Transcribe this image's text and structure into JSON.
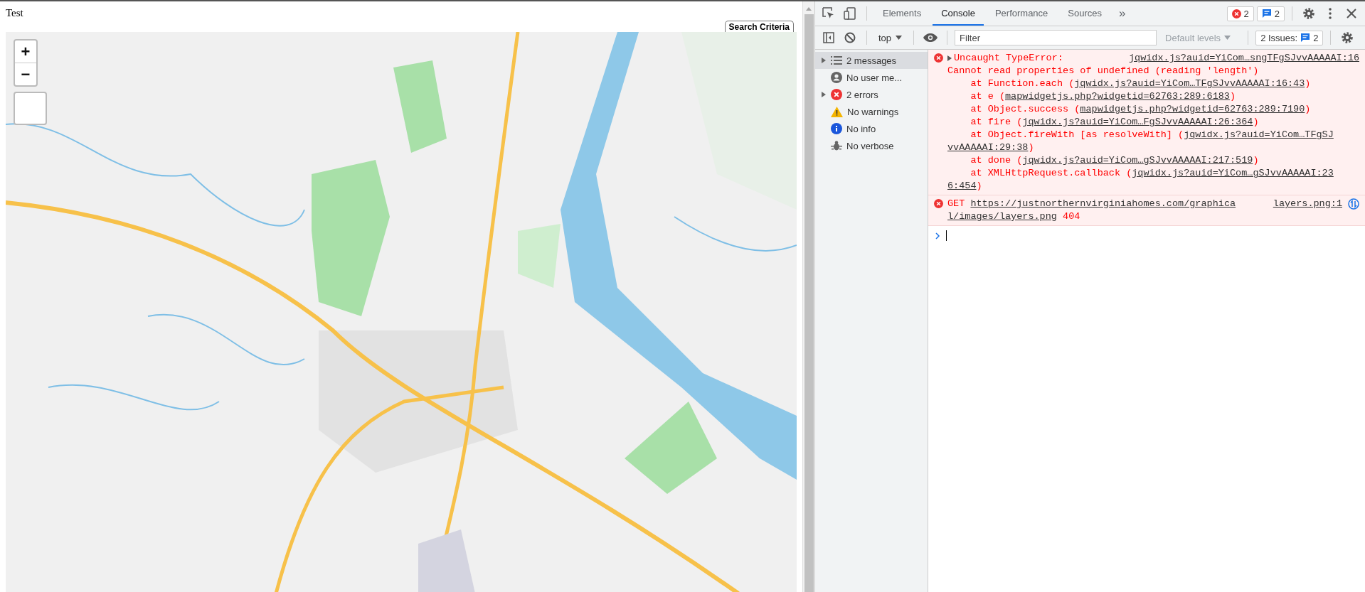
{
  "page": {
    "title": "Test",
    "search_tab": "Search Criteria",
    "map": {
      "kind": "picture",
      "zoom_in": "+",
      "zoom_out": "−"
    }
  },
  "devtools": {
    "tabs": [
      {
        "label": "Elements",
        "selected": false
      },
      {
        "label": "Console",
        "selected": true
      },
      {
        "label": "Performance",
        "selected": false
      },
      {
        "label": "Sources",
        "selected": false
      }
    ],
    "more_tabs": "»",
    "error_badge": "2",
    "message_badge": "2",
    "toolbar": {
      "context": "top",
      "filter_placeholder": "Filter",
      "levels": "Default levels",
      "issues_label": "2 Issues:",
      "issues_count": "2"
    },
    "sidebar": [
      {
        "kind": "messages",
        "label": "2 messages",
        "expandable": true,
        "selected": true
      },
      {
        "kind": "user",
        "label": "No user me...",
        "expandable": false,
        "selected": false
      },
      {
        "kind": "errors",
        "label": "2 errors",
        "expandable": true,
        "selected": false
      },
      {
        "kind": "warnings",
        "label": "No warnings",
        "expandable": false,
        "selected": false
      },
      {
        "kind": "info",
        "label": "No info",
        "expandable": false,
        "selected": false
      },
      {
        "kind": "verbose",
        "label": "No verbose",
        "expandable": false,
        "selected": false
      }
    ],
    "messages": [
      {
        "kind": "error",
        "expandable": true,
        "head": "Uncaught TypeError:",
        "source": "jqwidx.js?auid=YiCom…sngTFgSJvvAAAAAI:16",
        "lines": [
          [
            {
              "text": "Cannot read properties of undefined (reading 'length')",
              "link": false
            }
          ],
          [
            {
              "text": "    at Function.each (",
              "link": false
            },
            {
              "text": "jqwidx.js?auid=YiCom…TFgSJvvAAAAAI:16:43",
              "link": true
            },
            {
              "text": ")",
              "link": false
            }
          ],
          [
            {
              "text": "    at e (",
              "link": false
            },
            {
              "text": "mapwidgetjs.php?widgetid=62763:289:6183",
              "link": true
            },
            {
              "text": ")",
              "link": false
            }
          ],
          [
            {
              "text": "    at Object.success (",
              "link": false
            },
            {
              "text": "mapwidgetjs.php?widgetid=62763:289:7190",
              "link": true
            },
            {
              "text": ")",
              "link": false
            }
          ],
          [
            {
              "text": "    at fire (",
              "link": false
            },
            {
              "text": "jqwidx.js?auid=YiCom…FgSJvvAAAAAI:26:364",
              "link": true
            },
            {
              "text": ")",
              "link": false
            }
          ],
          [
            {
              "text": "    at Object.fireWith [as resolveWith] (",
              "link": false
            },
            {
              "text": "jqwidx.js?auid=YiCom…TFgSJ",
              "link": true
            }
          ],
          [
            {
              "text": "vvAAAAAI:29:38",
              "link": true
            },
            {
              "text": ")",
              "link": false
            }
          ],
          [
            {
              "text": "    at done (",
              "link": false
            },
            {
              "text": "jqwidx.js?auid=YiCom…gSJvvAAAAAI:217:519",
              "link": true
            },
            {
              "text": ")",
              "link": false
            }
          ],
          [
            {
              "text": "    at XMLHttpRequest.callback (",
              "link": false
            },
            {
              "text": "jqwidx.js?auid=YiCom…gSJvvAAAAAI:23",
              "link": true
            }
          ],
          [
            {
              "text": "6:454",
              "link": true
            },
            {
              "text": ")",
              "link": false
            }
          ]
        ]
      },
      {
        "kind": "network",
        "expandable": false,
        "head": "GET",
        "source": "layers.png:1",
        "lines": [
          [
            {
              "text": "l/images/layers.png",
              "link": true
            },
            {
              "text": " 404",
              "link": false
            }
          ]
        ],
        "head_link": "https://justnorthernvirginiahomes.com/graphica"
      }
    ]
  }
}
